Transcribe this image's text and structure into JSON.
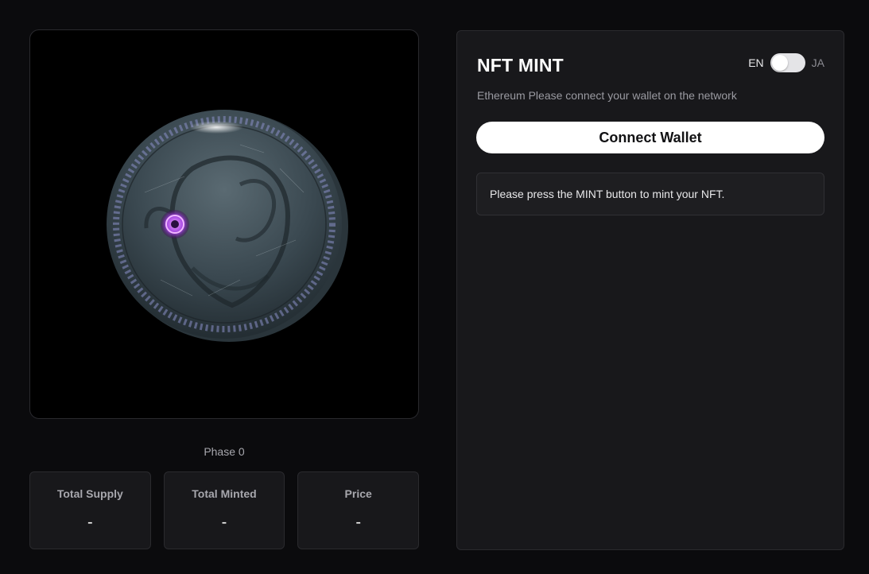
{
  "artwork": {
    "alt": "Alien coin NFT artwork"
  },
  "phase": "Phase 0",
  "stats": [
    {
      "label": "Total Supply",
      "value": "-"
    },
    {
      "label": "Total Minted",
      "value": "-"
    },
    {
      "label": "Price",
      "value": "-"
    }
  ],
  "panel": {
    "title": "NFT MINT",
    "subtitle": "Ethereum Please connect your wallet on the network",
    "connect_label": "Connect Wallet",
    "notice": "Please press the MINT button to mint your NFT."
  },
  "language": {
    "left": "EN",
    "right": "JA",
    "selected": "EN"
  },
  "colors": {
    "background": "#0b0b0d",
    "panel": "#18181b",
    "coin": "#3a4850",
    "accent": "#c070ff"
  }
}
